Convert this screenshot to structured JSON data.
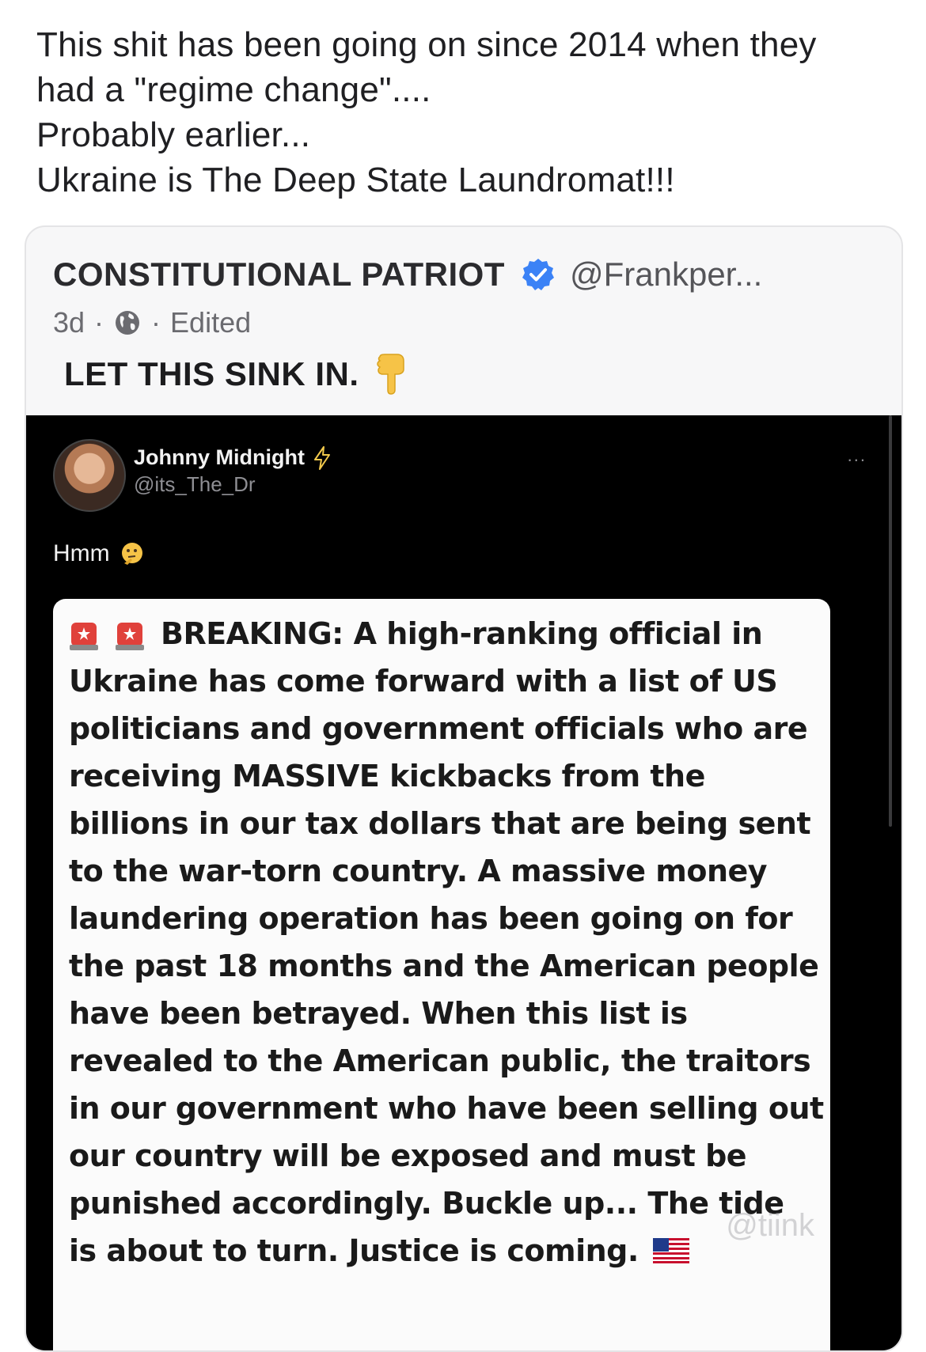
{
  "post": {
    "lines": [
      "This shit has been going on since 2014 when they",
      "had a \"regime change\"....",
      "Probably earlier...",
      "Ukraine is The Deep State Laundromat!!!"
    ]
  },
  "quoted_post": {
    "author_name": "CONSTITUTIONAL PATRIOT",
    "author_handle": "@Frankper...",
    "time": "3d",
    "separator": "·",
    "edited": "Edited",
    "caption": "LET THIS SINK IN.",
    "caption_emoji_icon": "backhand-index-pointing-down-icon",
    "verified_color": "#3b82f6"
  },
  "embedded_tweet": {
    "name": "Johnny Midnight",
    "handle": "@its_The_Dr",
    "more": "...",
    "text": "Hmm",
    "breaking_lines": [
      "BREAKING: A high-ranking official in",
      "Ukraine has come forward with a list of US",
      "politicians and government officials who are",
      "receiving MASSIVE kickbacks from the",
      "billions in our tax dollars that are being sent",
      "to the war-torn country. A massive money",
      "laundering operation has been going on for",
      "the past 18 months and the American people",
      "have been betrayed. When this list is",
      "revealed to the American public, the traitors",
      "in our government who have been selling out",
      "our country will be exposed and must be",
      "punished accordingly. Buckle up... The tide",
      "is about to turn. Justice is coming."
    ],
    "watermark": "@tiink"
  }
}
